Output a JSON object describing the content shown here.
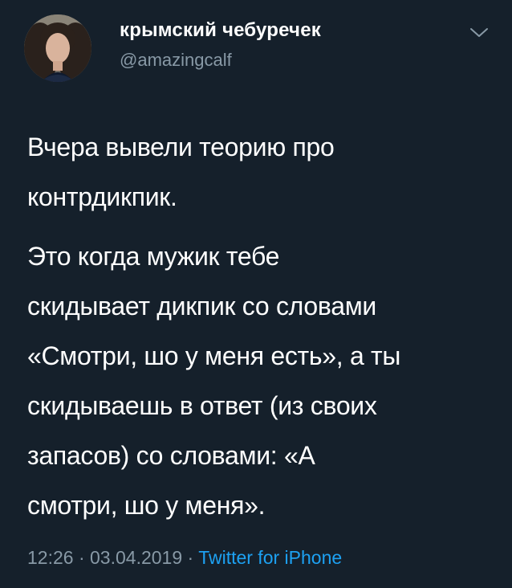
{
  "user": {
    "display_name": "крымский чебуречек",
    "handle": "@amazingcalf",
    "avatar_icon": "avatar"
  },
  "menu": {
    "icon": "chevron-down-icon",
    "color": "#8899a6"
  },
  "tweet": {
    "paragraphs": [
      "Вчера вывели теорию про\nконтрдикпик.",
      "Это когда мужик тебе\nскидывает дикпик со словами\n«Смотри, шо у меня есть», а ты\nскидываешь в ответ (из своих\nзапасов) со словами: «А\nсмотри, шо у меня»."
    ]
  },
  "meta": {
    "time": "12:26",
    "separator": "·",
    "date": "03.04.2019",
    "source": "Twitter for iPhone"
  },
  "colors": {
    "background": "#15202b",
    "text": "#ffffff",
    "secondary": "#8899a6",
    "link": "#1da1f2"
  }
}
